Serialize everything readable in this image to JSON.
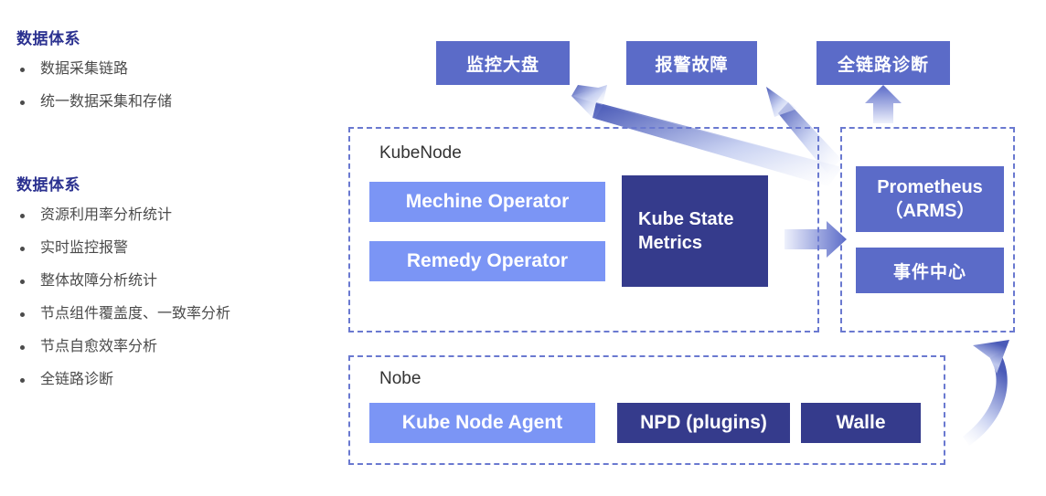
{
  "colors": {
    "heading": "#2b3190",
    "body_text": "#4b4b4b",
    "box_mid": "#5b6bc8",
    "box_light": "#7b95f5",
    "box_dark": "#353b8c",
    "frame_dash": "#6a79d0",
    "arrow": "#5b6bc8"
  },
  "sidebar": {
    "section1": {
      "title": "数据体系",
      "items": [
        "数据采集链路",
        "统一数据采集和存储"
      ]
    },
    "section2": {
      "title": "数据体系",
      "items": [
        "资源利用率分析统计",
        "实时监控报警",
        "整体故障分析统计",
        "节点组件覆盖度、一致率分析",
        "节点自愈效率分析",
        "全链路诊断"
      ]
    }
  },
  "diagram": {
    "top_boxes": [
      {
        "label": "监控大盘"
      },
      {
        "label": "报警故障"
      },
      {
        "label": "全链路诊断"
      }
    ],
    "kubenode": {
      "title": "KubeNode",
      "boxes": [
        {
          "label": "Mechine Operator"
        },
        {
          "label": "Remedy Operator"
        },
        {
          "label": "Kube State Metrics"
        }
      ]
    },
    "observability": {
      "boxes": [
        {
          "label": "Prometheus\n（ARMS）",
          "line1": "Prometheus",
          "line2": "（ARMS）"
        },
        {
          "label": "事件中心"
        }
      ]
    },
    "nobe": {
      "title": "Nobe",
      "boxes": [
        {
          "label": "Kube Node Agent"
        },
        {
          "label": "NPD (plugins)"
        },
        {
          "label": "Walle"
        }
      ]
    },
    "arrows": [
      {
        "name": "kube-state-metrics-to-prometheus",
        "direction": "right"
      },
      {
        "name": "prometheus-to-monitoring-dashboard",
        "direction": "up-left"
      },
      {
        "name": "prometheus-to-alert-fault",
        "direction": "up-left"
      },
      {
        "name": "prometheus-to-full-link-diagnosis",
        "direction": "up"
      },
      {
        "name": "nobe-to-observability",
        "direction": "curve-up"
      }
    ]
  }
}
